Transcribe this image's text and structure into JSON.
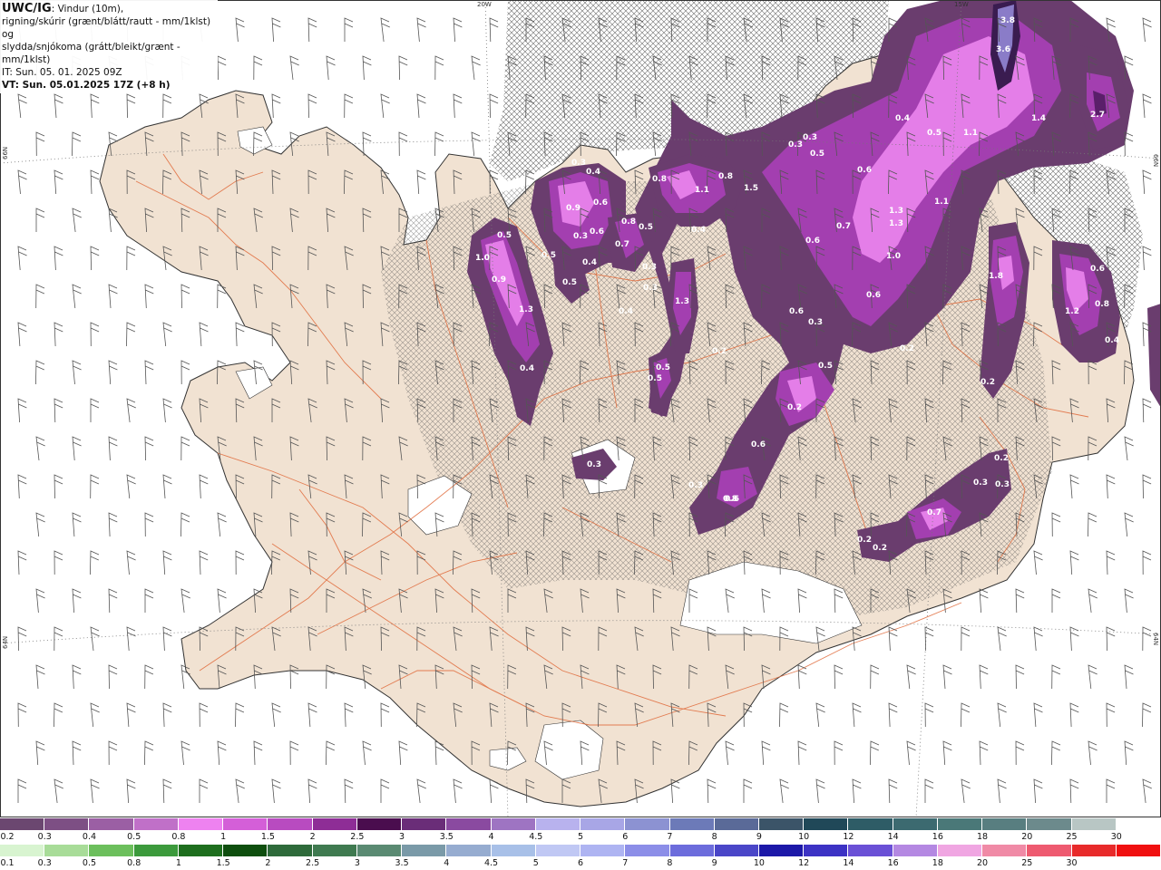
{
  "info": {
    "line1_bold": "UWC/IG",
    "line1_rest": ": Vindur (10m),",
    "line2": "rigning/skúrir (grænt/blátt/rautt - mm/1klst) og",
    "line3": "slydda/snjókoma (grátt/bleikt/grænt - mm/1klst)",
    "line4": "IT: Sun. 05. 01. 2025 09Z",
    "line5": "VT: Sun. 05.01.2025 17Z (+8 h)"
  },
  "grid_labels": {
    "lon_20w": "20W",
    "lon_15w": "15W",
    "lat_66n_left": "66N",
    "lat_66n_right": "66N",
    "lat_64n_left": "64N",
    "lat_64n_right": "64N"
  },
  "colors": {
    "land": "#f1e2d2",
    "sea": "#ffffff",
    "roads": "#e06a3a",
    "coast": "#333333",
    "precip_dark": "#6a3d6e",
    "precip_mid": "#a33fb0",
    "precip_light": "#e47ee8",
    "precip_max": "#b0a6e0"
  },
  "precip_values": [
    {
      "label": "3.8"
    },
    {
      "label": "3.6"
    },
    {
      "label": "2.7"
    },
    {
      "label": "1.4"
    },
    {
      "label": "0.4"
    },
    {
      "label": "0.5"
    },
    {
      "label": "1.1"
    },
    {
      "label": "0.3"
    },
    {
      "label": "0.3"
    },
    {
      "label": "0.5"
    },
    {
      "label": "0.6"
    },
    {
      "label": "0.8"
    },
    {
      "label": "1.3"
    },
    {
      "label": "1.3"
    },
    {
      "label": "1.1"
    },
    {
      "label": "1.5"
    },
    {
      "label": "0.8"
    },
    {
      "label": "1.1"
    },
    {
      "label": "0.6"
    },
    {
      "label": "0.4"
    },
    {
      "label": "0.7"
    },
    {
      "label": "0.6"
    },
    {
      "label": "1.0"
    },
    {
      "label": "0.6"
    },
    {
      "label": "0.3"
    },
    {
      "label": "0.4"
    },
    {
      "label": "1.0"
    },
    {
      "label": "0.9"
    },
    {
      "label": "0.6"
    },
    {
      "label": "0.3"
    },
    {
      "label": "0.5"
    },
    {
      "label": "0.5"
    },
    {
      "label": "0.7"
    },
    {
      "label": "0.8"
    },
    {
      "label": "0.5"
    },
    {
      "label": "0.4"
    },
    {
      "label": "0.5"
    },
    {
      "label": "0.3"
    },
    {
      "label": "0.3"
    },
    {
      "label": "0.4"
    },
    {
      "label": "1.3"
    },
    {
      "label": "0.2"
    },
    {
      "label": "0.5"
    },
    {
      "label": "0.5"
    },
    {
      "label": "0.6"
    },
    {
      "label": "0.3"
    },
    {
      "label": "0.2"
    },
    {
      "label": "0.5"
    },
    {
      "label": "0.2"
    },
    {
      "label": "0.6"
    },
    {
      "label": "0.3"
    },
    {
      "label": "0.6"
    },
    {
      "label": "0.3"
    },
    {
      "label": "1.0"
    },
    {
      "label": "0.9"
    },
    {
      "label": "1.3"
    },
    {
      "label": "0.4"
    },
    {
      "label": "1.8"
    },
    {
      "label": "0.2"
    },
    {
      "label": "1.2"
    },
    {
      "label": "0.6"
    },
    {
      "label": "0.8"
    },
    {
      "label": "0.4"
    },
    {
      "label": "0.2"
    },
    {
      "label": "0.3"
    },
    {
      "label": "0.3"
    },
    {
      "label": "0.7"
    },
    {
      "label": "0.2"
    },
    {
      "label": "0.2"
    },
    {
      "label": "0.8"
    }
  ],
  "legend_top": {
    "labels": [
      "0.2",
      "0.3",
      "0.4",
      "0.5",
      "0.8",
      "1",
      "1.5",
      "2",
      "2.5",
      "3",
      "3.5",
      "4",
      "4.5",
      "5",
      "6",
      "7",
      "8",
      "9",
      "10",
      "12",
      "14",
      "16",
      "18",
      "20",
      "25",
      "30"
    ],
    "colors": [
      "#6b4770",
      "#7d4f84",
      "#9b5fa4",
      "#c070c8",
      "#ee82f0",
      "#d45fd8",
      "#b84bc0",
      "#8e2d96",
      "#4a0d4e",
      "#6a2d78",
      "#8a4aa0",
      "#9e74c2",
      "#b8b2ee",
      "#a8a6e6",
      "#8c92d2",
      "#6c7ab8",
      "#5a6a98",
      "#3b5468",
      "#204858",
      "#2e5c66",
      "#3c6a70",
      "#4a7878",
      "#587e80",
      "#6c8a8c",
      "#b8c6c4",
      "#ffffff"
    ]
  },
  "legend_bottom": {
    "labels": [
      "0.1",
      "0.3",
      "0.5",
      "0.8",
      "1",
      "1.5",
      "2",
      "2.5",
      "3",
      "3.5",
      "4",
      "4.5",
      "5",
      "6",
      "7",
      "8",
      "9",
      "10",
      "12",
      "14",
      "16",
      "18",
      "20",
      "25",
      "30"
    ],
    "colors": [
      "#d8f4d0",
      "#a8dc98",
      "#6cbf5c",
      "#3c9a3c",
      "#1e6e1e",
      "#0e4e0e",
      "#2e6a3a",
      "#3f7a50",
      "#5a8a72",
      "#7a9aa8",
      "#96acd0",
      "#a8c0e8",
      "#c0c8f4",
      "#aeb4f2",
      "#8c8ee8",
      "#6c6cdc",
      "#4a46c8",
      "#1c18a8",
      "#3c32c4",
      "#6a50d6",
      "#b488e2",
      "#f0a6e2",
      "#f08aa6",
      "#ee5a70",
      "#e82a2a",
      "#f01010"
    ]
  }
}
